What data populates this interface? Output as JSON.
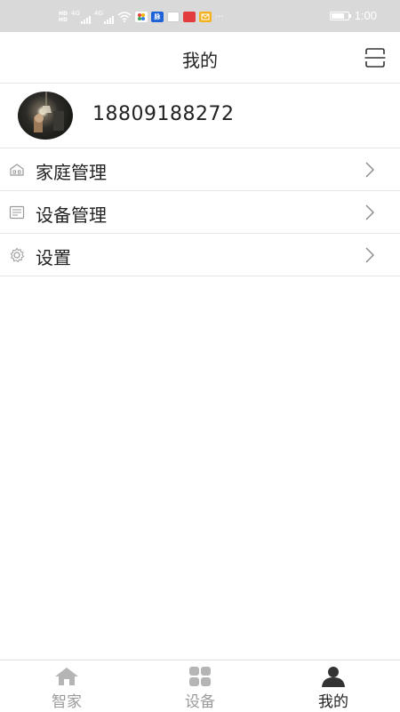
{
  "status_bar": {
    "network_top": "HD",
    "network_bottom": "HD",
    "signal_1": "4G",
    "signal_2": "4G",
    "app_icon_label": "脉",
    "time": "1:00",
    "battery_level": 0.8
  },
  "header": {
    "title": "我的",
    "scan_icon": "scan-icon"
  },
  "profile": {
    "phone": "18809188272",
    "avatar_icon": "user-avatar"
  },
  "menu": {
    "items": [
      {
        "label": "家庭管理",
        "icon": "home-icon"
      },
      {
        "label": "设备管理",
        "icon": "device-list-icon"
      },
      {
        "label": "设置",
        "icon": "gear-icon"
      }
    ]
  },
  "bottom_nav": {
    "tabs": [
      {
        "label": "智家",
        "icon": "home-icon",
        "active": false
      },
      {
        "label": "设备",
        "icon": "grid-icon",
        "active": false
      },
      {
        "label": "我的",
        "icon": "person-icon",
        "active": true
      }
    ]
  },
  "colors": {
    "status_bar_bg": "#d9d9d9",
    "divider": "#e6e6e6",
    "inactive": "#9a9a9a",
    "active": "#222222"
  }
}
